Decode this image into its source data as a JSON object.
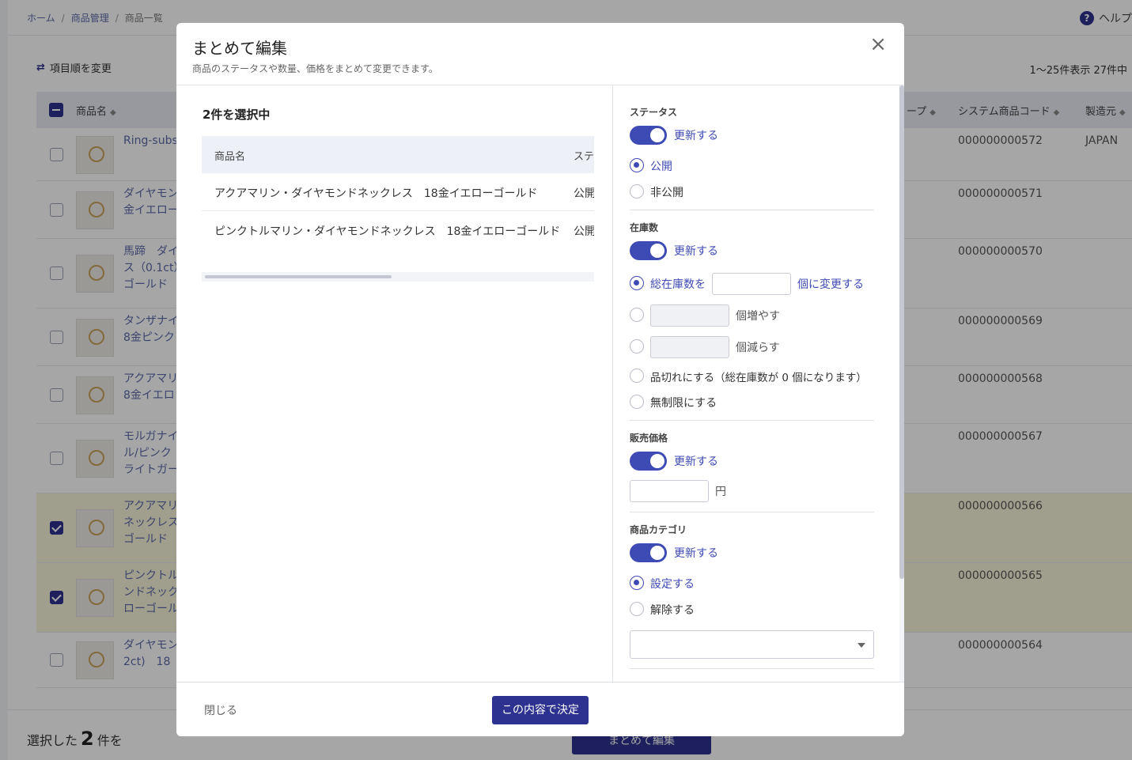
{
  "breadcrumb": {
    "home": "ホーム",
    "products": "商品管理",
    "current": "商品一覧"
  },
  "help": {
    "label": "ヘルプ"
  },
  "toolbar": {
    "reorder_label": "項目順を変更",
    "count_label": "1〜25件表示 27件中"
  },
  "table": {
    "headers": {
      "name": "商品名",
      "group": "ープ",
      "system_code": "システム商品コード",
      "origin": "製造元"
    },
    "rows": [
      {
        "name": "Ring-subs",
        "code": "000000000572",
        "origin": "JAPAN",
        "selected": false
      },
      {
        "name": "ダイヤモン",
        "name2": "金イエロー",
        "code": "000000000571",
        "origin": "",
        "selected": false
      },
      {
        "name": "馬蹄　ダイ",
        "name2": "ス（0.1ct）",
        "name3": "ゴールド",
        "code": "000000000570",
        "origin": "",
        "selected": false
      },
      {
        "name": "タンザナイ",
        "name2": "8金ピンク",
        "code": "000000000569",
        "origin": "",
        "selected": false
      },
      {
        "name": "アクアマリ",
        "name2": "8金イエロ",
        "code": "000000000568",
        "origin": "",
        "selected": false
      },
      {
        "name": "モルガナイ",
        "name2": "ル/ピンク",
        "name3": "ライトガー",
        "code": "000000000567",
        "origin": "",
        "selected": false
      },
      {
        "name": "アクアマリ",
        "name2": "ネックレス",
        "name3": "ゴールド",
        "code": "000000000566",
        "origin": "",
        "selected": true
      },
      {
        "name": "ピンクトル",
        "name2": "ンドネック",
        "name3": "ローゴール",
        "code": "000000000565",
        "origin": "",
        "selected": true
      },
      {
        "name": "ダイヤモン",
        "name2": "2ct)　18",
        "code": "000000000564",
        "origin": "",
        "selected": false
      }
    ]
  },
  "footer": {
    "selected_prefix": "選択した",
    "selected_count": "2",
    "selected_suffix": "件を",
    "bulk_edit_label": "まとめて編集"
  },
  "modal": {
    "title": "まとめて編集",
    "subtitle": "商品のステータスや数量、価格をまとめて変更できます。",
    "close_icon": "×",
    "selected_count_label": "2件を選択中",
    "product_table": {
      "headers": [
        "商品名",
        "ステー"
      ],
      "rows": [
        [
          "アクアマリン・ダイヤモンドネックレス　18金イエローゴールド",
          "公開"
        ],
        [
          "ピンクトルマリン・ダイヤモンドネックレス　18金イエローゴールド",
          "公開"
        ]
      ]
    },
    "status": {
      "title": "ステータス",
      "toggle_label": "更新する",
      "option_public": "公開",
      "option_private": "非公開"
    },
    "stock": {
      "title": "在庫数",
      "toggle_label": "更新する",
      "total_prefix": "総在庫数を",
      "total_suffix": "個に変更する",
      "increase_suffix": "個増やす",
      "decrease_suffix": "個減らす",
      "soldout": "品切れにする（総在庫数が 0 個になります）",
      "unlimited": "無制限にする"
    },
    "price": {
      "title": "販売価格",
      "toggle_label": "更新する",
      "unit": "円"
    },
    "category": {
      "title": "商品カテゴリ",
      "toggle_label": "更新する",
      "option_set": "設定する",
      "option_unset": "解除する"
    },
    "close_label": "閉じる",
    "confirm_label": "この内容で決定"
  },
  "colors": {
    "primary": "#2d3290",
    "accent": "#3f4bb4",
    "selected_row": "#f6f3d8"
  }
}
